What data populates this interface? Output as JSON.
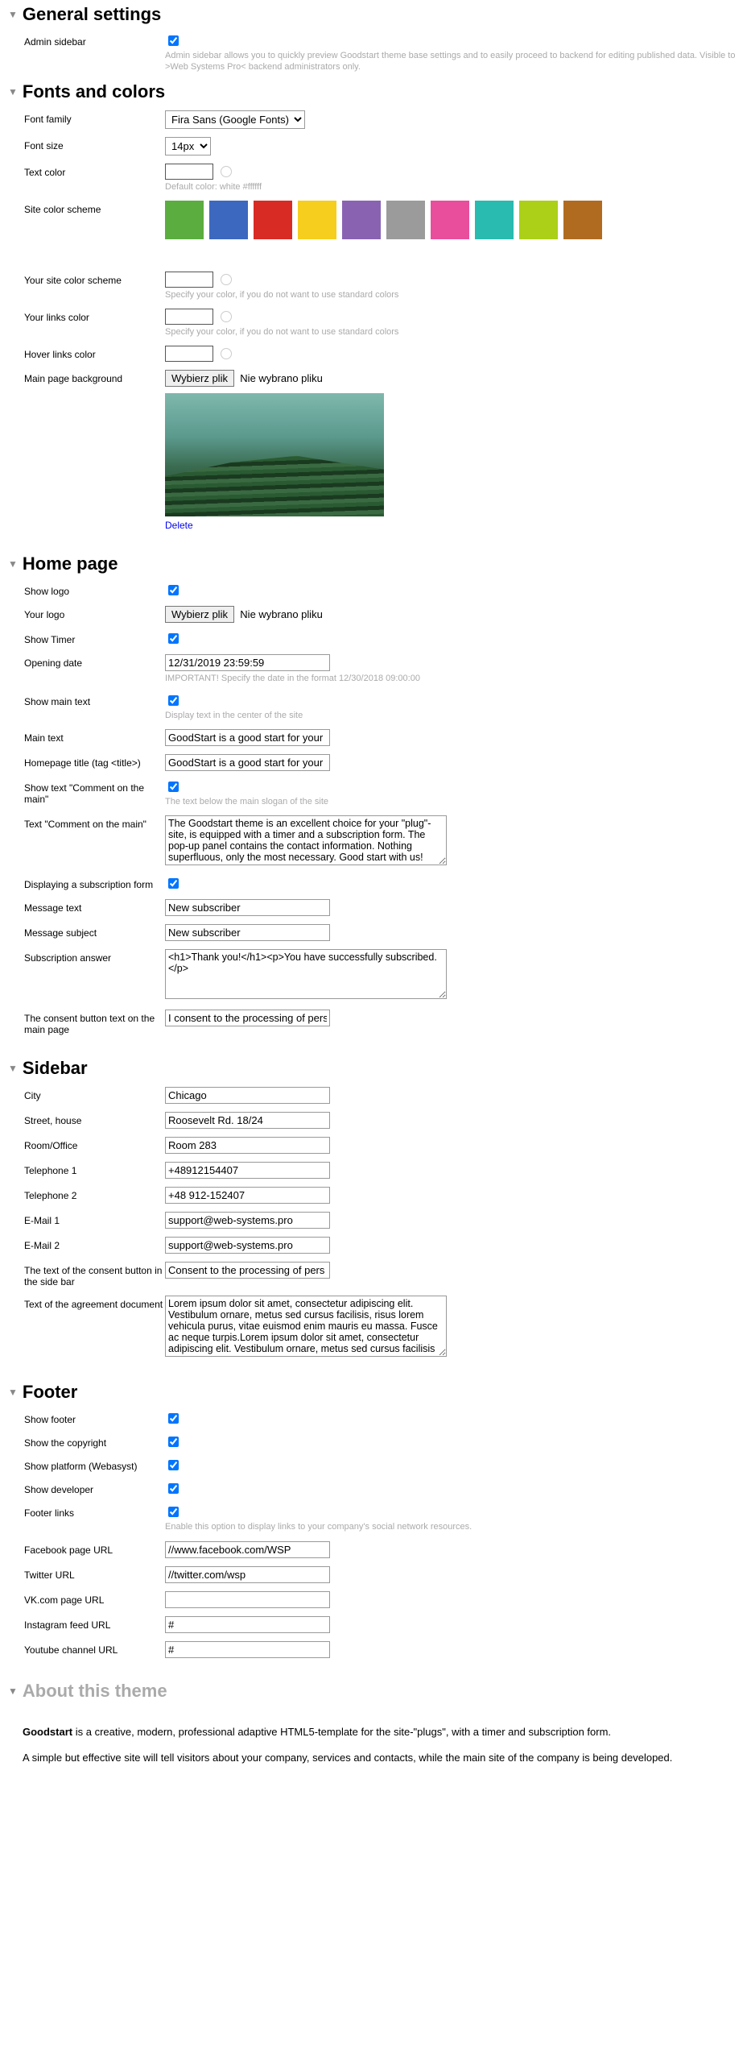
{
  "sections": {
    "general": "General settings",
    "fonts": "Fonts and colors",
    "homepage": "Home page",
    "sidebar": "Sidebar",
    "footer": "Footer",
    "about": "About this theme"
  },
  "general": {
    "admin_sidebar_label": "Admin sidebar",
    "admin_sidebar_help": "Admin sidebar allows you to quickly preview Goodstart theme base settings and to easily proceed to backend for editing published data. Visible to >Web Systems Pro< backend administrators only."
  },
  "fonts": {
    "family_label": "Font family",
    "family_value": "Fira Sans (Google Fonts)",
    "size_label": "Font size",
    "size_value": "14px",
    "text_color_label": "Text color",
    "text_color_help": "Default color: white #ffffff",
    "scheme_label": "Site color scheme",
    "scheme_colors": [
      "#5bad3f",
      "#3c68c0",
      "#d82b24",
      "#f6ce1e",
      "#8963b2",
      "#9b9b9b",
      "#e94e9c",
      "#29bab0",
      "#abd017",
      "#b06b21"
    ],
    "your_scheme_label": "Your site color scheme",
    "your_scheme_help": "Specify your color, if you do not want to use standard colors",
    "links_label": "Your links color",
    "links_help": "Specify your color, if you do not want to use standard colors",
    "hover_label": "Hover links color",
    "bg_label": "Main page background",
    "file_btn": "Wybierz plik",
    "file_none": "Nie wybrano pliku",
    "delete": "Delete"
  },
  "homepage": {
    "show_logo_label": "Show logo",
    "your_logo_label": "Your logo",
    "file_btn": "Wybierz plik",
    "file_none": "Nie wybrano pliku",
    "show_timer_label": "Show Timer",
    "opening_label": "Opening date",
    "opening_value": "12/31/2019 23:59:59",
    "opening_help": "IMPORTANT! Specify the date in the format 12/30/2018 09:00:00",
    "show_main_label": "Show main text",
    "show_main_help": "Display text in the center of the site",
    "main_text_label": "Main text",
    "main_text_value": "GoodStart is a good start for your",
    "title_label": "Homepage title (tag <title>)",
    "title_value": "GoodStart is a good start for your",
    "show_comment_label": "Show text \"Comment on the main\"",
    "show_comment_help": "The text below the main slogan of the site",
    "comment_label": "Text \"Comment on the main\"",
    "comment_value": "The Goodstart theme is an excellent choice for your \"plug\"-site, is equipped with a timer and a subscription form. The pop-up panel contains the contact information. Nothing superfluous, only the most necessary. Good start with us!",
    "show_sub_label": "Displaying a subscription form",
    "msg_text_label": "Message text",
    "msg_text_value": "New subscriber",
    "msg_subj_label": "Message subject",
    "msg_subj_value": "New subscriber",
    "sub_answer_label": "Subscription answer",
    "sub_answer_value": "<h1>Thank you!</h1><p>You have successfully subscribed.</p>",
    "consent_btn_label": "The consent button text on the main page",
    "consent_btn_value": "I consent to the processing of pers"
  },
  "sidebar": {
    "city_label": "City",
    "city_value": "Chicago",
    "street_label": "Street, house",
    "street_value": "Roosevelt Rd. 18/24",
    "room_label": "Room/Office",
    "room_value": "Room 283",
    "tel1_label": "Telephone 1",
    "tel1_value": "+48912154407",
    "tel2_label": "Telephone 2",
    "tel2_value": "+48 912-152407",
    "email1_label": "E-Mail 1",
    "email1_value": "support@web-systems.pro",
    "email2_label": "E-Mail 2",
    "email2_value": "support@web-systems.pro",
    "consent_side_label": "The text of the consent button in the side bar",
    "consent_side_value": "Consent to the processing of pers",
    "agreement_label": "Text of the agreement document",
    "agreement_value": "Lorem ipsum dolor sit amet, consectetur adipiscing elit. Vestibulum ornare, metus sed cursus facilisis, risus lorem vehicula purus, vitae euismod enim mauris eu massa. Fusce ac neque turpis.Lorem ipsum dolor sit amet, consectetur adipiscing elit. Vestibulum ornare, metus sed cursus facilisis"
  },
  "footer": {
    "show_footer_label": "Show footer",
    "show_copy_label": "Show the copyright",
    "show_platform_label": "Show platform (Webasyst)",
    "show_dev_label": "Show developer",
    "links_label": "Footer links",
    "links_help": "Enable this option to display links to your company's social network resources.",
    "fb_label": "Facebook page URL",
    "fb_value": "//www.facebook.com/WSP",
    "tw_label": "Twitter URL",
    "tw_value": "//twitter.com/wsp",
    "vk_label": "VK.com page URL",
    "vk_value": "",
    "ig_label": "Instagram feed URL",
    "ig_value": "#",
    "yt_label": "Youtube channel URL",
    "yt_value": "#"
  },
  "about": {
    "p1_bold": "Goodstart",
    "p1_rest": " is a creative, modern, professional adaptive HTML5-template for the site-\"plugs\", with a timer and subscription form.",
    "p2": "A simple but effective site will tell visitors about your company, services and contacts, while the main site of the company is being developed."
  }
}
